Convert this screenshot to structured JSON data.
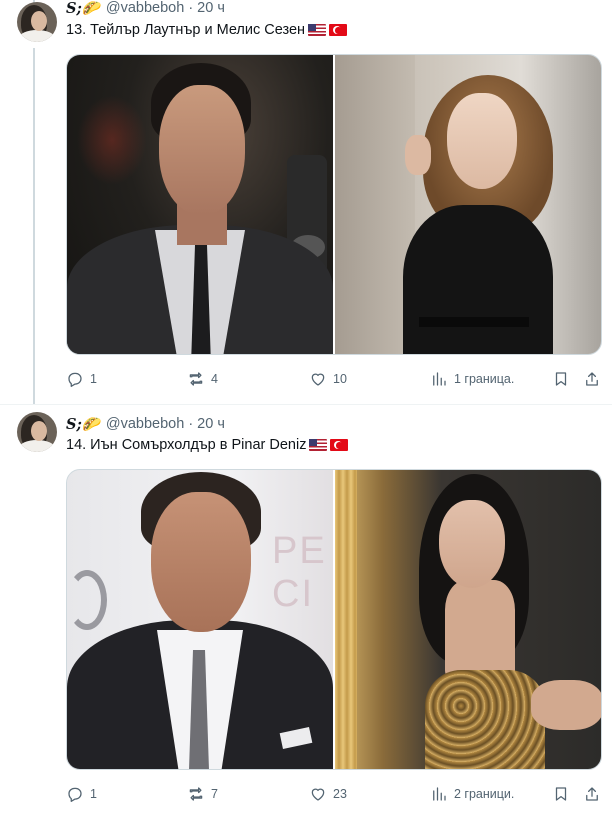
{
  "tweets": [
    {
      "display_name": "S;🌮",
      "handle": "@vabbeboh",
      "separator": "·",
      "time": "20 ч",
      "text": "13. Тейлър Лаутнър и Мелис Сезен",
      "flags": [
        "us-flag",
        "tr-flag"
      ],
      "stats": {
        "replies": "1",
        "reposts": "4",
        "likes": "10",
        "views": "1 граница."
      }
    },
    {
      "display_name": "S;🌮",
      "handle": "@vabbeboh",
      "separator": "·",
      "time": "20 ч",
      "text": "14. Иън Сомърхолдър в Pinar Deniz",
      "flags": [
        "us-flag",
        "tr-flag"
      ],
      "stats": {
        "replies": "1",
        "reposts": "7",
        "likes": "23",
        "views": "2 граници."
      },
      "photo_text": "PE CI"
    }
  ]
}
